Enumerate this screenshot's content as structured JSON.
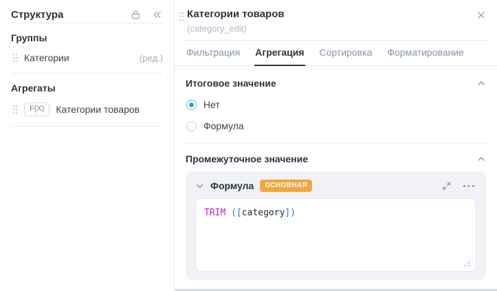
{
  "sidebar": {
    "title": "Структура",
    "groups": {
      "label": "Группы",
      "items": [
        {
          "label": "Категории",
          "suffix": "(ред.)"
        }
      ]
    },
    "aggregates": {
      "label": "Агрегаты",
      "items": [
        {
          "badge": "F(X)",
          "label": "Категории товаров"
        }
      ]
    }
  },
  "panel": {
    "title": "Категории товаров",
    "subtitle": "(category_edit)",
    "tabs": [
      {
        "label": "Фильтрация",
        "active": false
      },
      {
        "label": "Агрегация",
        "active": true
      },
      {
        "label": "Сортировка",
        "active": false
      },
      {
        "label": "Форматирование",
        "active": false
      }
    ],
    "total_section": {
      "title": "Итоговое значение",
      "options": [
        {
          "label": "Нет",
          "selected": true
        },
        {
          "label": "Формула",
          "selected": false
        }
      ]
    },
    "intermediate_section": {
      "title": "Промежуточное значение",
      "card": {
        "title": "Формула",
        "badge": "ОСНОВНАЯ",
        "code": "TRIM ([category])",
        "tokens": [
          {
            "text": "TRIM",
            "type": "function",
            "color": "#bf25c4"
          },
          {
            "text": " (",
            "type": "paren",
            "color": "#2a6be0"
          },
          {
            "text": "[",
            "type": "bracket",
            "color": "#2a6be0"
          },
          {
            "text": "category",
            "type": "field",
            "color": "#1f2430"
          },
          {
            "text": "]",
            "type": "bracket",
            "color": "#2a6be0"
          },
          {
            "text": ")",
            "type": "paren",
            "color": "#2a6be0"
          }
        ]
      }
    }
  },
  "colors": {
    "accent_teal_ring": "#52c7c7",
    "accent_teal_dot": "#3aa6c1",
    "badge_orange": "#f2a63e",
    "tab_active": "#2e323d",
    "tab_inactive": "#8593ac",
    "divider": "#e8ebf0",
    "card_background": "#f0f2f7",
    "icon_gray": "#9ba4b8"
  }
}
